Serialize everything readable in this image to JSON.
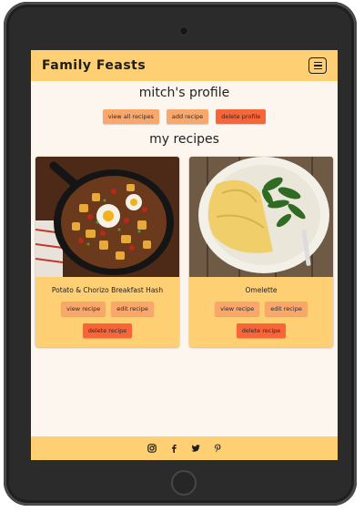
{
  "navbar": {
    "brand": "Family Feasts",
    "menu_icon": "hamburger-menu-icon"
  },
  "profile": {
    "title": "mitch's profile",
    "actions": {
      "view_all": "view all recipes",
      "add": "add recipe",
      "delete_profile": "delete profile"
    }
  },
  "recipes_section": {
    "title": "my recipes"
  },
  "recipes": [
    {
      "title": "Potato & Chorizo Breakfast Hash",
      "view": "view recipe",
      "edit": "edit recipe",
      "delete": "delete recipe"
    },
    {
      "title": "Omelette",
      "view": "view recipe",
      "edit": "edit recipe",
      "delete": "delete recipe"
    }
  ],
  "footer": {
    "icons": [
      "instagram-icon",
      "facebook-icon",
      "twitter-icon",
      "pinterest-icon"
    ]
  },
  "colors": {
    "brand_yellow": "#ffd073",
    "button_orange": "#f9a76a",
    "button_red": "#f76538",
    "page_bg": "#fdf6ee"
  }
}
